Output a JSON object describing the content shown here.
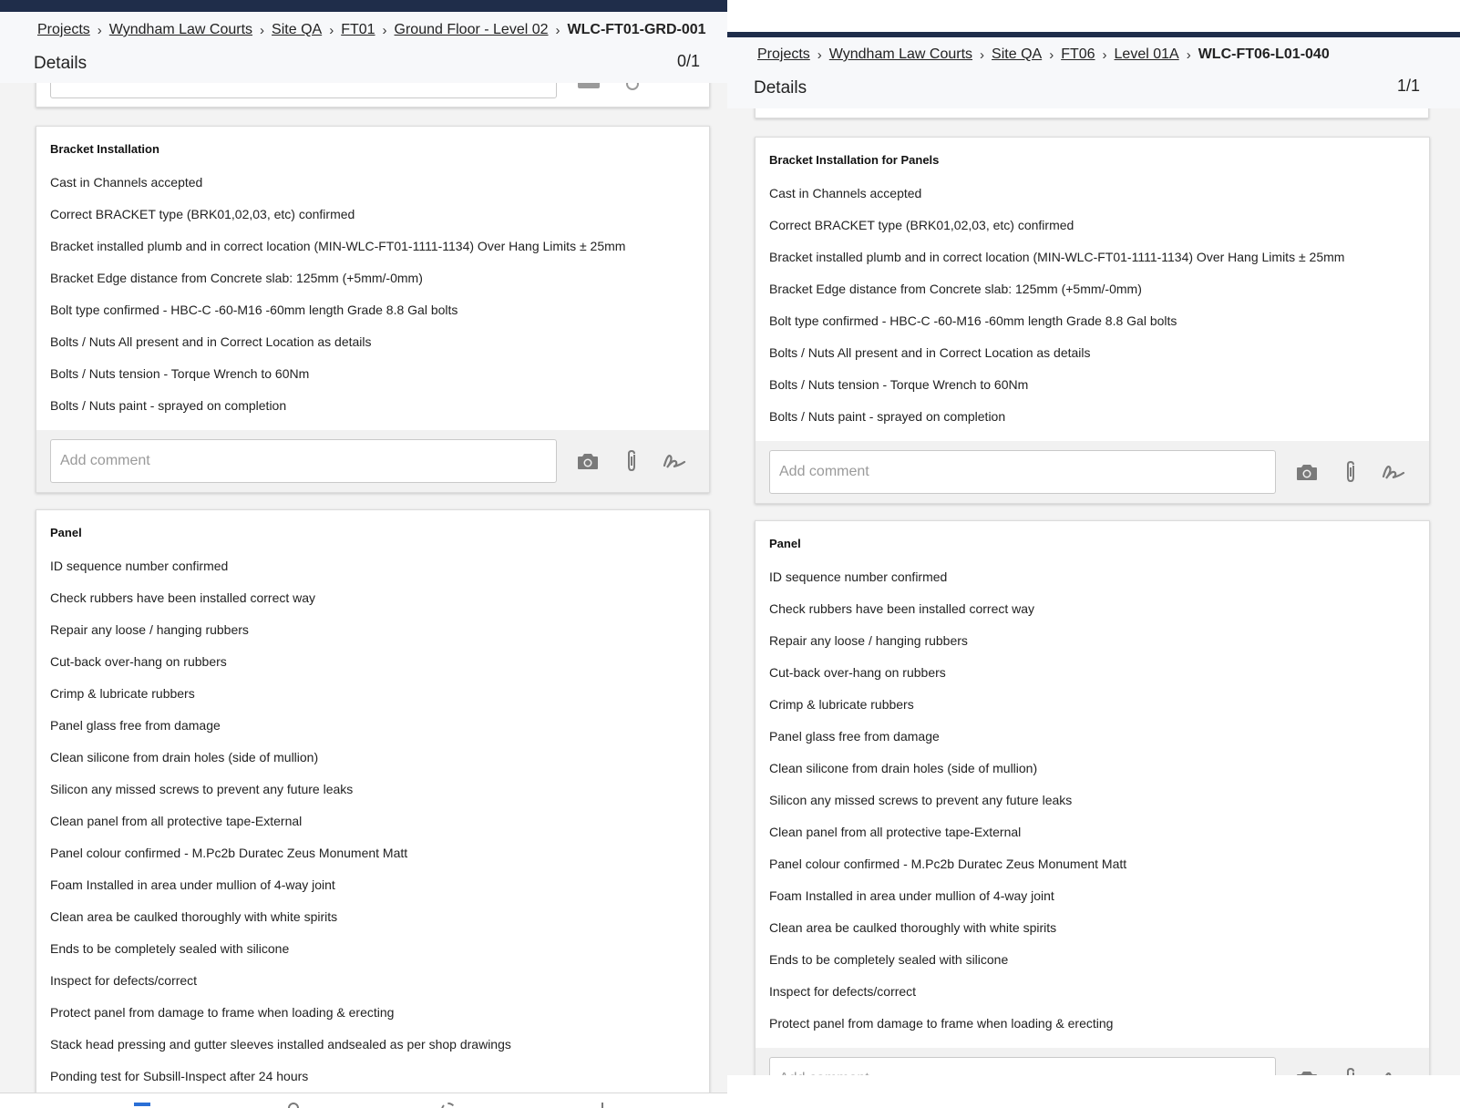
{
  "colors": {
    "topbar": "#1f2d4a",
    "icon": "#7a7a7a",
    "nav_active": "#2a6fd6"
  },
  "left": {
    "breadcrumb": [
      "Projects",
      "Wyndham Law Courts",
      "Site QA",
      "FT01",
      "Ground Floor - Level 02"
    ],
    "current": "WLC-FT01-GRD-001",
    "details_title": "Details",
    "count": "0/1",
    "bracket": {
      "title": "Bracket Installation",
      "items": [
        "Cast in Channels accepted",
        "Correct BRACKET type (BRK01,02,03, etc) confirmed",
        "Bracket installed plumb and in correct location (MIN-WLC-FT01-1111-1134) Over Hang Limits ± 25mm",
        "Bracket Edge distance from Concrete slab: 125mm (+5mm/-0mm)",
        "Bolt type confirmed - HBC-C -60-M16 -60mm length Grade 8.8 Gal bolts",
        "Bolts / Nuts All present and in Correct Location as details",
        "Bolts / Nuts tension - Torque Wrench to 60Nm",
        "Bolts / Nuts paint - sprayed on completion"
      ],
      "comment_placeholder": "Add comment"
    },
    "panel": {
      "title": "Panel",
      "items": [
        "ID sequence number confirmed",
        "Check rubbers have been installed correct way",
        "Repair any loose / hanging rubbers",
        "Cut-back over-hang on rubbers",
        "Crimp & lubricate rubbers",
        "Panel glass free from damage",
        "Clean silicone from drain holes (side of mullion)",
        "Silicon any missed screws to prevent any future leaks",
        "Clean panel from all protective tape-External",
        "Panel colour confirmed - M.Pc2b Duratec Zeus Monument Matt",
        "Foam Installed in area under mullion of 4-way joint",
        "Clean area be caulked thoroughly with white spirits",
        "Ends to be completely sealed with silicone",
        "Inspect for defects/correct",
        "Protect panel from damage to frame when loading & erecting",
        "Stack head pressing and gutter sleeves installed andsealed as per shop drawings",
        "Ponding test for Subsill-Inspect after 24 hours"
      ]
    }
  },
  "right": {
    "breadcrumb": [
      "Projects",
      "Wyndham Law Courts",
      "Site QA",
      "FT06",
      "Level 01A"
    ],
    "current": "WLC-FT06-L01-040",
    "details_title": "Details",
    "count": "1/1",
    "bracket": {
      "title": "Bracket Installation for Panels",
      "items": [
        "Cast in Channels accepted",
        "Correct BRACKET type (BRK01,02,03, etc) confirmed",
        "Bracket installed plumb and in correct location (MIN-WLC-FT01-1111-1134) Over Hang Limits ± 25mm",
        "Bracket Edge distance from Concrete slab: 125mm (+5mm/-0mm)",
        "Bolt type confirmed - HBC-C -60-M16 -60mm length Grade 8.8 Gal bolts",
        "Bolts / Nuts All present and in Correct Location as details",
        "Bolts / Nuts tension - Torque Wrench to 60Nm",
        "Bolts / Nuts paint - sprayed on completion"
      ],
      "comment_placeholder": "Add comment"
    },
    "panel": {
      "title": "Panel",
      "items": [
        "ID sequence number confirmed",
        "Check rubbers have been installed correct way",
        "Repair any loose / hanging rubbers",
        "Cut-back over-hang on rubbers",
        "Crimp & lubricate rubbers",
        "Panel glass free from damage",
        "Clean silicone from drain holes (side of mullion)",
        "Silicon any missed screws to prevent any future leaks",
        "Clean panel from all protective tape-External",
        "Panel colour confirmed - M.Pc2b Duratec Zeus Monument Matt",
        "Foam Installed in area under mullion of 4-way joint",
        "Clean area be caulked thoroughly with white spirits",
        "Ends to be completely sealed with silicone",
        "Inspect for defects/correct",
        "Protect panel from damage to frame when loading & erecting"
      ],
      "comment_placeholder": "Add comment"
    }
  }
}
